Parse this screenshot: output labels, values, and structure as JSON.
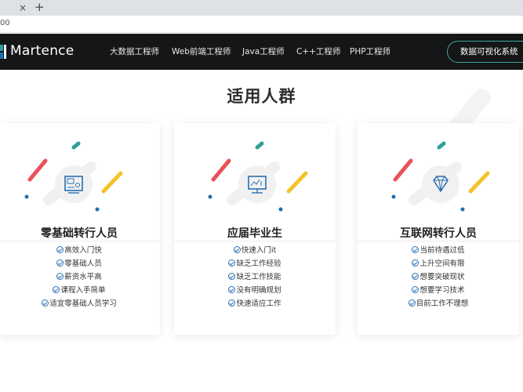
{
  "browser": {
    "close_glyph": "×",
    "new_tab_glyph": "+",
    "address": "00"
  },
  "header": {
    "brand": "Martence",
    "nav": [
      "大数据工程师",
      "Web前端工程师",
      "Java工程师",
      "C++工程师",
      "PHP工程师"
    ],
    "cta": "数据可视化系统"
  },
  "section": {
    "title": "适用人群"
  },
  "cards": [
    {
      "icon": "computer-chart-icon",
      "title": "零基础转行人员",
      "items": [
        "高效入门快",
        "零基础人员",
        "薪资水平高",
        "课程入手简单",
        "适宜零基础人员学习"
      ]
    },
    {
      "icon": "computer-presentation-icon",
      "title": "应届毕业生",
      "items": [
        "快速入门it",
        "缺乏工作经验",
        "缺乏工作技能",
        "没有明确规划",
        "快速适应工作"
      ]
    },
    {
      "icon": "diamond-icon",
      "title": "互联网转行人员",
      "items": [
        "当前待遇过低",
        "上升空间有限",
        "想要突破现状",
        "想要学习技术",
        "目前工作不理想"
      ]
    }
  ],
  "colors": {
    "navbar": "#141617",
    "accent_teal": "#2ba199",
    "accent_red": "#e8525a",
    "accent_yellow": "#f4c22b",
    "accent_blue": "#1f6fb2"
  }
}
